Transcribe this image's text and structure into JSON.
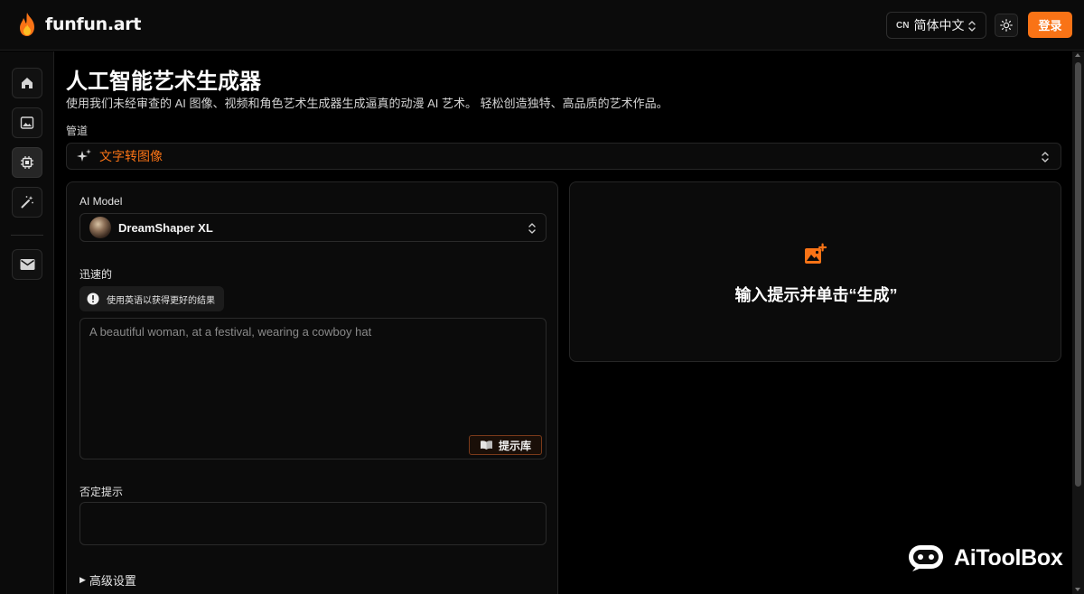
{
  "header": {
    "brand": "funfun.art",
    "language": {
      "code": "CN",
      "label": "简体中文"
    },
    "login_label": "登录",
    "accent_color": "#f97316"
  },
  "sidebar": {
    "items": [
      {
        "icon": "home-icon"
      },
      {
        "icon": "image-icon"
      },
      {
        "icon": "cpu-icon",
        "active": true
      },
      {
        "icon": "magic-wand-icon"
      },
      {
        "icon": "mail-icon"
      }
    ]
  },
  "main": {
    "title": "人工智能艺术生成器",
    "subtitle": "使用我们未经审查的 AI 图像、视频和角色艺术生成器生成逼真的动漫 AI 艺术。 轻松创造独特、高品质的艺术作品。",
    "pipeline": {
      "label": "管道",
      "value": "文字转图像"
    }
  },
  "form": {
    "model": {
      "label": "AI Model",
      "value": "DreamShaper XL"
    },
    "prompt": {
      "label": "迅速的",
      "hint": "使用英语以获得更好的结果",
      "placeholder": "A beautiful woman, at a festival, wearing a cowboy hat",
      "library_label": "提示库"
    },
    "negative_prompt": {
      "label": "否定提示",
      "value": ""
    },
    "advanced_label": "高级设置"
  },
  "output": {
    "empty_text": "输入提示并单击“生成”"
  },
  "watermark": {
    "text": "AiToolBox"
  }
}
